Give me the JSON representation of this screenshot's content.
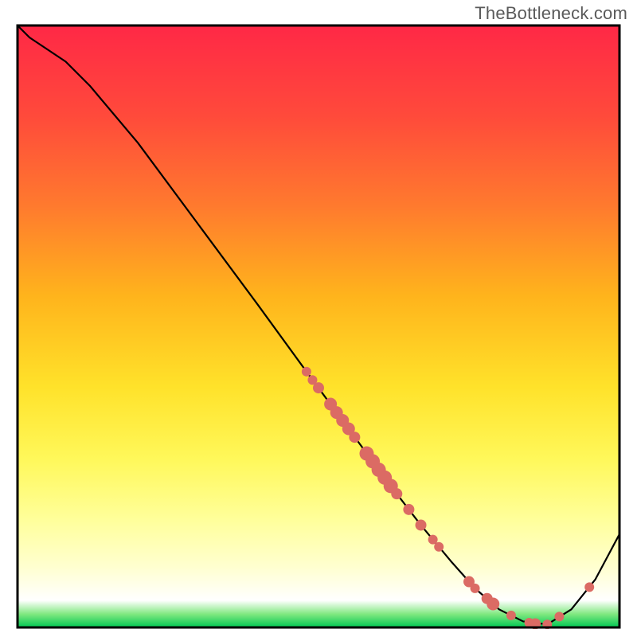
{
  "watermark": "TheBottleneck.com",
  "chart_data": {
    "type": "line",
    "title": "",
    "xlabel": "",
    "ylabel": "",
    "xlim": [
      0,
      100
    ],
    "ylim": [
      0,
      100
    ],
    "grid": false,
    "legend": false,
    "background_gradient": {
      "stops": [
        {
          "offset": 0.0,
          "color": "#ff2846"
        },
        {
          "offset": 0.15,
          "color": "#ff4a3b"
        },
        {
          "offset": 0.3,
          "color": "#ff7a2e"
        },
        {
          "offset": 0.45,
          "color": "#ffb41c"
        },
        {
          "offset": 0.6,
          "color": "#ffe22a"
        },
        {
          "offset": 0.72,
          "color": "#fff85a"
        },
        {
          "offset": 0.82,
          "color": "#ffff9a"
        },
        {
          "offset": 0.9,
          "color": "#ffffd0"
        },
        {
          "offset": 0.955,
          "color": "#ffffff"
        },
        {
          "offset": 0.978,
          "color": "#7fe87f"
        },
        {
          "offset": 1.0,
          "color": "#00c853"
        }
      ]
    },
    "series": [
      {
        "name": "curve",
        "x": [
          0.0,
          2.0,
          5.0,
          8.0,
          12.0,
          20.0,
          30.0,
          40.0,
          48.0,
          55.0,
          62.0,
          67.0,
          72.0,
          76.0,
          80.0,
          84.0,
          88.0,
          92.0,
          96.0,
          100.0
        ],
        "y": [
          100.0,
          98.0,
          96.0,
          94.0,
          90.0,
          80.5,
          67.0,
          53.5,
          42.5,
          33.0,
          23.5,
          17.0,
          11.0,
          6.5,
          3.0,
          1.0,
          0.5,
          3.0,
          8.0,
          15.5
        ]
      }
    ],
    "highlight_points": {
      "name": "dots",
      "color": "#db6b64",
      "points": [
        {
          "x": 48.0,
          "y": 42.5,
          "r": 6
        },
        {
          "x": 49.0,
          "y": 41.1,
          "r": 6
        },
        {
          "x": 50.0,
          "y": 39.8,
          "r": 7
        },
        {
          "x": 52.0,
          "y": 37.1,
          "r": 8
        },
        {
          "x": 53.0,
          "y": 35.7,
          "r": 8
        },
        {
          "x": 54.0,
          "y": 34.4,
          "r": 8
        },
        {
          "x": 55.0,
          "y": 33.0,
          "r": 8
        },
        {
          "x": 56.0,
          "y": 31.6,
          "r": 7
        },
        {
          "x": 58.0,
          "y": 28.9,
          "r": 9
        },
        {
          "x": 59.0,
          "y": 27.6,
          "r": 9
        },
        {
          "x": 60.0,
          "y": 26.2,
          "r": 9
        },
        {
          "x": 61.0,
          "y": 24.9,
          "r": 9
        },
        {
          "x": 62.0,
          "y": 23.5,
          "r": 9
        },
        {
          "x": 63.0,
          "y": 22.2,
          "r": 7
        },
        {
          "x": 65.0,
          "y": 19.6,
          "r": 7
        },
        {
          "x": 67.0,
          "y": 17.0,
          "r": 7
        },
        {
          "x": 69.0,
          "y": 14.6,
          "r": 6
        },
        {
          "x": 70.0,
          "y": 13.4,
          "r": 6
        },
        {
          "x": 75.0,
          "y": 7.6,
          "r": 7
        },
        {
          "x": 76.0,
          "y": 6.5,
          "r": 6
        },
        {
          "x": 78.0,
          "y": 4.8,
          "r": 7
        },
        {
          "x": 79.0,
          "y": 3.9,
          "r": 8
        },
        {
          "x": 82.0,
          "y": 2.0,
          "r": 6
        },
        {
          "x": 85.0,
          "y": 0.8,
          "r": 6
        },
        {
          "x": 86.0,
          "y": 0.6,
          "r": 7
        },
        {
          "x": 88.0,
          "y": 0.5,
          "r": 6
        },
        {
          "x": 90.0,
          "y": 1.8,
          "r": 6
        },
        {
          "x": 95.0,
          "y": 6.7,
          "r": 6
        }
      ]
    }
  }
}
